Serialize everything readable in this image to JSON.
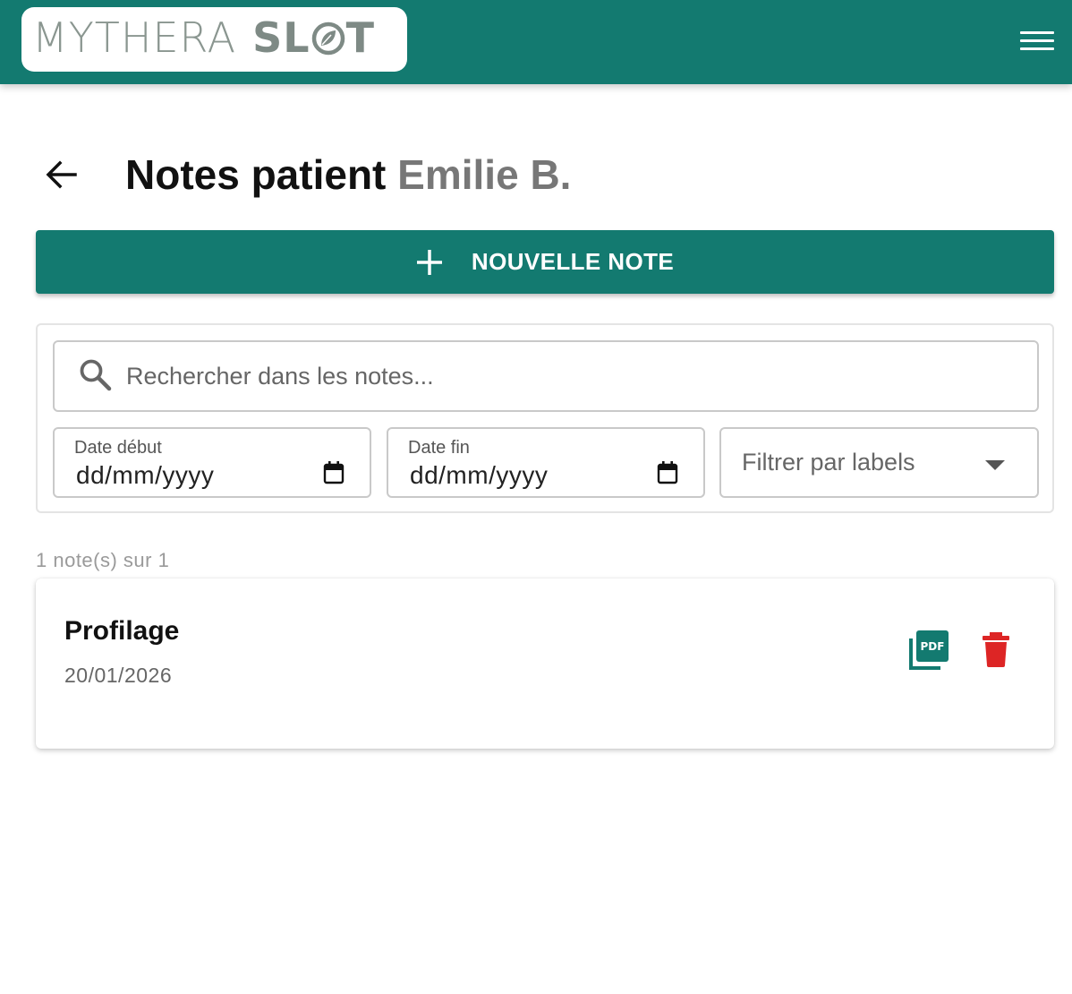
{
  "header": {
    "logo_part1": "MYTHERA",
    "logo_part2a": "SL",
    "logo_part2b": "T",
    "logo_leaf_icon": "leaf-icon",
    "menu_icon": "hamburger-menu-icon",
    "brand_color": "#137a70"
  },
  "page": {
    "back_icon": "arrow-left-icon",
    "title": "Notes patient",
    "patient_name": "Emilie B."
  },
  "new_note_button": {
    "icon": "plus-icon",
    "label": "NOUVELLE NOTE"
  },
  "filters": {
    "search": {
      "icon": "search-icon",
      "placeholder": "Rechercher dans les notes...",
      "value": ""
    },
    "date_start": {
      "label": "Date début",
      "value": "dd/mm/yyyy",
      "icon": "calendar-icon"
    },
    "date_end": {
      "label": "Date fin",
      "value": "dd/mm/yyyy",
      "icon": "calendar-icon"
    },
    "labels_select": {
      "placeholder": "Filtrer par labels",
      "icon": "caret-down-icon"
    }
  },
  "results": {
    "count_text": "1 note(s) sur 1",
    "notes": [
      {
        "title": "Profilage",
        "date": "20/01/2026",
        "pdf_icon": "picture-as-pdf-icon",
        "pdf_icon_label": "PDF",
        "delete_icon": "trash-icon",
        "pdf_color": "#137a70",
        "delete_color": "#dd2525"
      }
    ]
  }
}
